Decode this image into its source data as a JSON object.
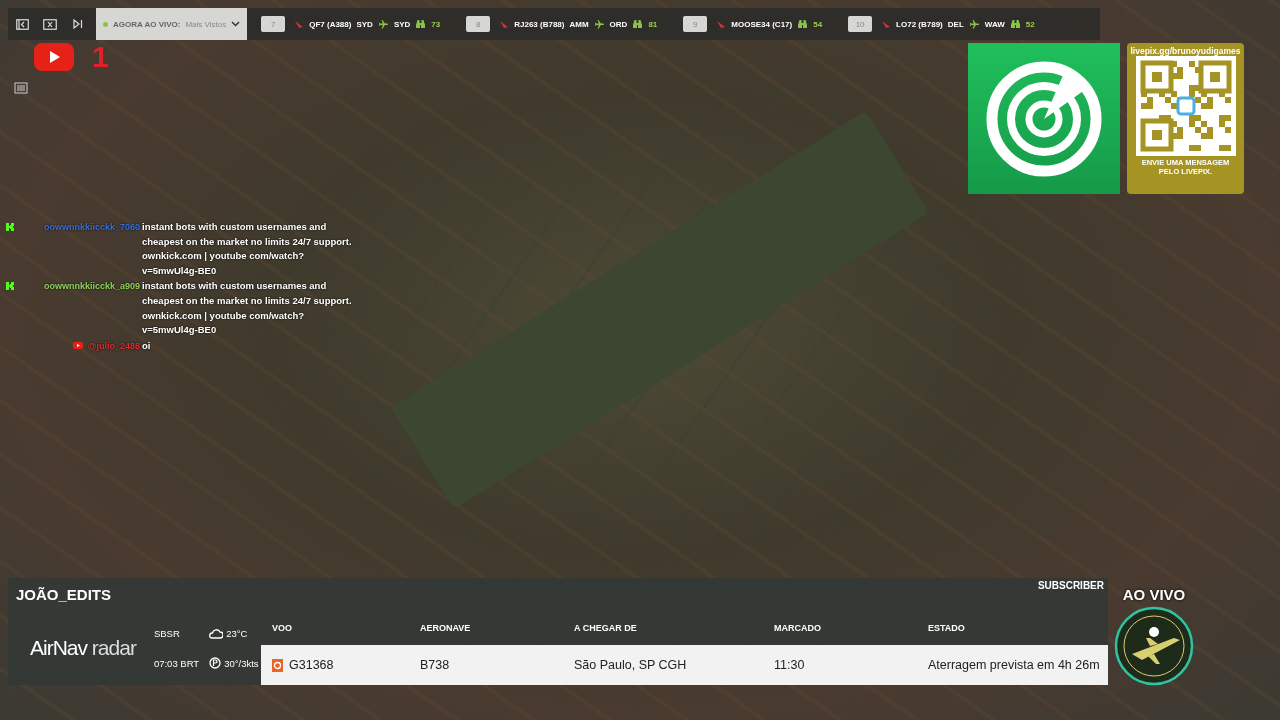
{
  "top_bar": {
    "filter": {
      "label": "AGORA AO VIVO:",
      "value": "Mais Vistos"
    },
    "flights": [
      {
        "kind": "route",
        "rank": "7",
        "callsign": "QF7 (A388)",
        "origin": "SYD",
        "destination": "SYD",
        "watchers": "73"
      },
      {
        "kind": "route",
        "rank": "8",
        "callsign": "RJ263 (B788)",
        "origin": "AMM",
        "destination": "ORD",
        "watchers": "81"
      },
      {
        "kind": "plain",
        "rank": "9",
        "callsign": "MOOSE34 (C17)",
        "watchers": "54"
      },
      {
        "kind": "route",
        "rank": "10",
        "callsign": "LO72 (B789)",
        "origin": "DEL",
        "destination": "WAW",
        "watchers": "52"
      }
    ]
  },
  "youtube": {
    "count": "1"
  },
  "chat": [
    {
      "kind": "kick",
      "user": "oowwnnkkiicckk_7060",
      "color": "#3a6fd8",
      "message": "instant bots with custom usernames and cheapest on the market no limits 24/7 support. ownkick.com | youtube com/watch?v=5mwUl4g-BE0"
    },
    {
      "kind": "kick",
      "user": "oowwnnkkiicckk_a909",
      "color": "#8ed05a",
      "message": "instant bots with custom usernames and cheapest on the market no limits 24/7 support. ownkick.com | youtube com/watch?v=5mwUl4g-BE0"
    },
    {
      "kind": "youtube",
      "user": "@julio_2488",
      "color": "#d83030",
      "message": "oi"
    }
  ],
  "promo": {
    "url": "livepix.gg/brunoyudigames",
    "caption": "ENVIE UMA MENSAGEM PELO LIVEPIX."
  },
  "flight_panel": {
    "title": "JOÃO_EDITS",
    "badge": "SUBSCRIBER",
    "logo_bold": "AirNav",
    "logo_light": "radar",
    "airport": "SBSR",
    "time": "07:03 BRT",
    "temperature": "23°C",
    "wind": "30°/3kts",
    "columns": [
      "VOO",
      "AERONAVE",
      "A CHEGAR DE",
      "MARCADO",
      "ESTADO"
    ],
    "rows": [
      [
        "G31368",
        "B738",
        "São Paulo, SP CGH",
        "11:30",
        "Aterragem prevista em 4h 26m"
      ]
    ]
  },
  "live": {
    "label": "AO VIVO"
  }
}
